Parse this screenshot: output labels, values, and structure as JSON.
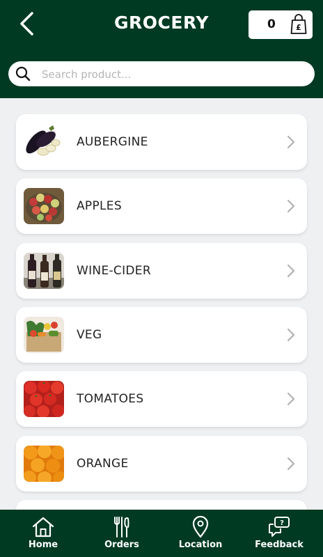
{
  "header": {
    "title": "GROCERY",
    "cart_count": "0",
    "currency_symbol": "£",
    "background_color": "#003a22"
  },
  "search": {
    "placeholder": "Search product...",
    "value": ""
  },
  "categories": [
    {
      "label": "AUBERGINE",
      "icon": "aubergine-image"
    },
    {
      "label": "APPLES",
      "icon": "apples-image"
    },
    {
      "label": "WINE-CIDER",
      "icon": "wine-cider-image"
    },
    {
      "label": "VEG",
      "icon": "veg-image"
    },
    {
      "label": "TOMATOES",
      "icon": "tomatoes-image"
    },
    {
      "label": "ORANGE",
      "icon": "orange-image"
    }
  ],
  "bottom_nav": {
    "items": [
      {
        "label": "Home",
        "icon": "home-icon"
      },
      {
        "label": "Orders",
        "icon": "cutlery-icon"
      },
      {
        "label": "Location",
        "icon": "location-pin-icon"
      },
      {
        "label": "Feedback",
        "icon": "feedback-chat-icon"
      }
    ]
  }
}
